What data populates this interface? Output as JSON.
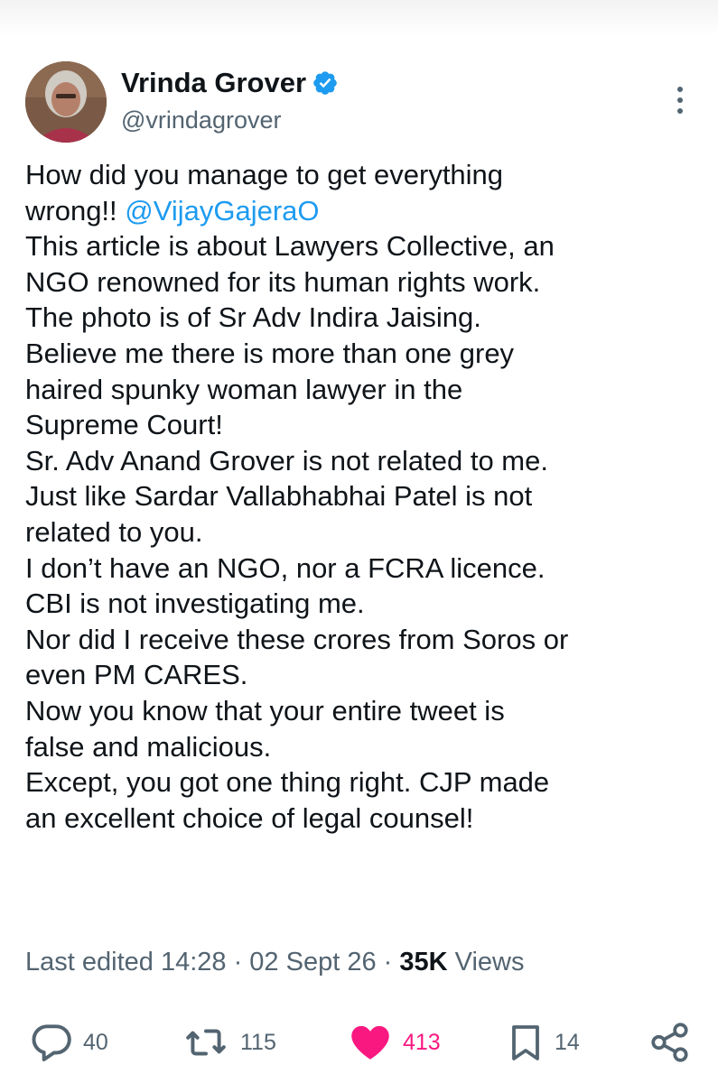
{
  "author": {
    "display_name": "Vrinda Grover",
    "handle": "@vrindagrover",
    "verified": true
  },
  "tweet": {
    "line_01a": "How did you manage to get everything",
    "line_02a": "wrong!! ",
    "line_02_mention": "@VijayGajeraO",
    "line_03": "This article is about Lawyers Collective, an",
    "line_04": "NGO renowned for its human rights work.",
    "line_05": "The photo is of Sr Adv Indira Jaising.",
    "line_06": "Believe me there is more than one grey",
    "line_07": "haired spunky woman lawyer in the",
    "line_08": "Supreme Court!",
    "line_09": "Sr. Adv Anand Grover is not related to me.",
    "line_10": "Just like Sardar Vallabhabhai Patel is not",
    "line_11": "related to you.",
    "line_12": "I don’t have an NGO, nor a FCRA licence.",
    "line_13": "CBI is not investigating me.",
    "line_14": "Nor did I receive these crores from Soros or",
    "line_15": "even PM CARES.",
    "line_16": "Now you know that your entire tweet is",
    "line_17": "false and malicious.",
    "line_18": "Except, you got one thing right. CJP made",
    "line_19": "an excellent choice of legal counsel!"
  },
  "meta": {
    "edited_label": "Last edited 14:28",
    "separator": " · ",
    "date": "02 Sept 26",
    "views_count": "35K",
    "views_label": " Views"
  },
  "actions": {
    "replies": "40",
    "reposts": "115",
    "likes": "413",
    "bookmarks": "14"
  },
  "icons": {
    "reply": "reply-icon",
    "repost": "repost-icon",
    "like": "heart-icon",
    "bookmark": "bookmark-icon",
    "share": "share-icon",
    "more": "more-vertical-icon",
    "verified": "verified-badge-icon"
  },
  "colors": {
    "link": "#1d9bf0",
    "like": "#f91880",
    "muted": "#536471",
    "text": "#0f1419"
  }
}
